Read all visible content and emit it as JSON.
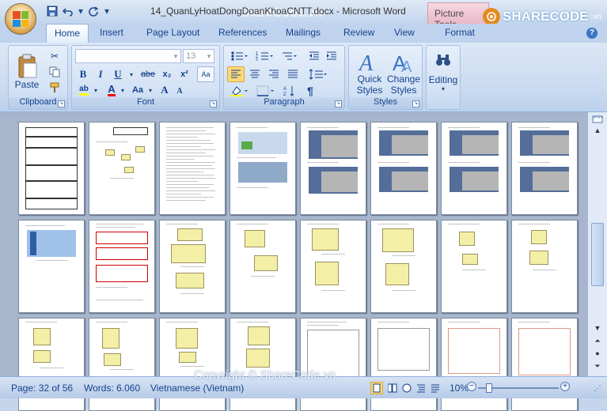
{
  "window": {
    "title": "14_QuanLyHoatDongDoanKhoaCNTT.docx - Microsoft Word",
    "contextual_tab_group": "Picture Tools",
    "watermark_top": "ShareCode.vn",
    "brand_name": "SHARECODE",
    "brand_suffix": ".vn"
  },
  "tabs": [
    "Home",
    "Insert",
    "Page Layout",
    "References",
    "Mailings",
    "Review",
    "View",
    "Format"
  ],
  "help_label": "?",
  "ribbon": {
    "clipboard": {
      "label": "Clipboard",
      "paste": "Paste"
    },
    "font": {
      "label": "Font",
      "font_name": "",
      "font_size": "13",
      "bold": "B",
      "italic": "I",
      "underline": "U",
      "strike": "abe",
      "subscript": "x₂",
      "superscript": "x²",
      "clear": "Aa",
      "grow": "A",
      "shrink": "A",
      "case": "Aa"
    },
    "paragraph": {
      "label": "Paragraph",
      "pilcrow": "¶"
    },
    "styles": {
      "label": "Styles",
      "quick": "Quick",
      "quick2": "Styles",
      "change": "Change",
      "change2": "Styles"
    },
    "editing": {
      "label": "Editing"
    }
  },
  "colors": {
    "accent": "#15428b",
    "highlight": "#ffff00",
    "font_color": "#ff0000"
  },
  "status": {
    "page": "Page: 32 of 56",
    "words": "Words: 6.060",
    "language": "Vietnamese (Vietnam)",
    "zoom": "10%"
  },
  "watermark": "Copyright © ShareCode.vn"
}
